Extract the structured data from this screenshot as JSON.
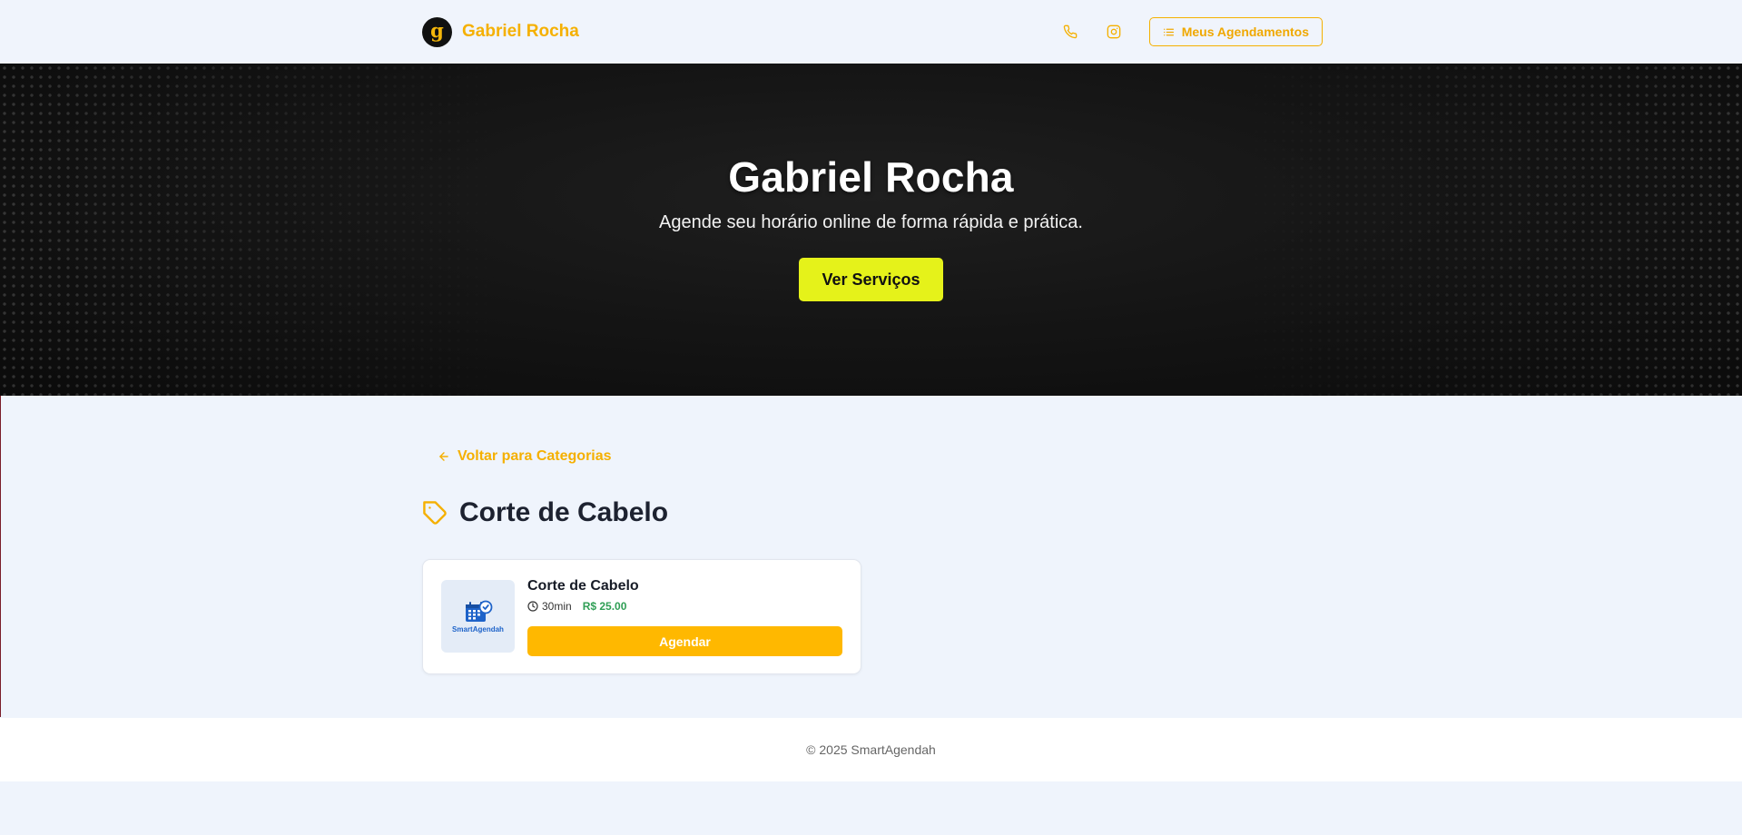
{
  "header": {
    "brand_name": "Gabriel Rocha",
    "logo_letter": "g",
    "appointments_label": "Meus Agendamentos",
    "accent_color": "#f5b000"
  },
  "hero": {
    "title": "Gabriel Rocha",
    "subtitle": "Agende seu horário online de forma rápida e prática.",
    "cta_label": "Ver Serviços",
    "cta_color": "#e5f21a"
  },
  "main": {
    "back_label": "Voltar para Categorias",
    "category_title": "Corte de Cabelo",
    "services": [
      {
        "name": "Corte de Cabelo",
        "duration": "30min",
        "price": "R$ 25.00",
        "thumb_text": "SmartAgendah",
        "book_label": "Agendar"
      }
    ]
  },
  "footer": {
    "text": "© 2025 SmartAgendah"
  }
}
